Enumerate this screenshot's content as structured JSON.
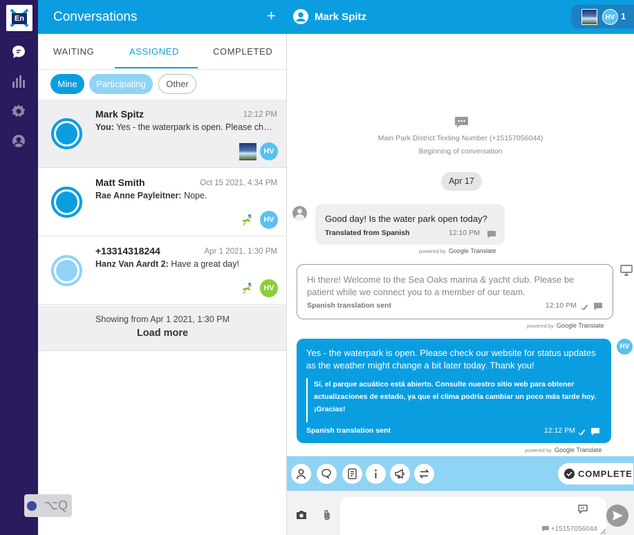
{
  "rail": {
    "logo_text": "En",
    "hint_text": "⌥Q",
    "accent": "#2a1a5e"
  },
  "conversations": {
    "title": "Conversations",
    "add_icon": "plus-icon",
    "tabs": [
      {
        "label": "WAITING"
      },
      {
        "label": "ASSIGNED",
        "active": true
      },
      {
        "label": "COMPLETED"
      }
    ],
    "filters": [
      {
        "label": "Mine",
        "active": true
      },
      {
        "label": "Participating"
      },
      {
        "label": "Other"
      }
    ],
    "items": [
      {
        "name": "Mark Spitz",
        "time": "12:12 PM",
        "sender": "You:",
        "preview": "Yes - the waterpark is open. Please check our website for status updates",
        "agent": "HV",
        "selected": true
      },
      {
        "name": "Matt Smith",
        "time": "Oct 15 2021, 4:34 PM",
        "sender": "Rae Anne Payleitner:",
        "preview": "Nope.",
        "agent": "HV"
      },
      {
        "name": "+13314318244",
        "time": "Apr 1 2021, 1:30 PM",
        "sender": "Hanz Van Aardt 2:",
        "preview": "Have a great day!",
        "agent": "HV"
      }
    ],
    "showing": "Showing from Apr 1 2021, 1:30 PM",
    "load_more": "Load more"
  },
  "chat": {
    "contact_name": "Mark Spitz",
    "agent_initials": "HV",
    "participant_count": "1",
    "system_line1": "Main Park District Texting Number (+15157056044)",
    "system_line2": "Beginning of conversation",
    "date_divider": "Apr 17",
    "messages": [
      {
        "text": "Good day! Is the water park open today?",
        "status": "Translated from Spanish",
        "time": "12:10 PM"
      },
      {
        "text": "Hi there!  Welcome to the Sea Oaks marina & yacht club.  Please be patient while we connect you to a member of our team.",
        "status": "Spanish translation sent",
        "time": "12:10 PM"
      },
      {
        "text": "Yes - the waterpark is open.  Please check our website for status updates as the weather might change a bit later today.  Thank you!",
        "translation": "Sí, el parque acuático está abierto. Consulte nuestro sitio web para obtener actualizaciones de estado, ya que el clima podría cambiar un poco más tarde hoy. ¡Gracias!",
        "status": "Spanish translation sent",
        "time": "12:12 PM",
        "agent": "HV"
      }
    ],
    "powered_by": "powered by",
    "google_translate": "Google Translate",
    "complete_label": "COMPLETE",
    "composer_placeholder": "",
    "from_number": "+15157056044"
  },
  "colors": {
    "brand_blue": "#0a9ee1",
    "light_blue": "#8fd3f5",
    "agent_green": "#8bcf3a"
  }
}
